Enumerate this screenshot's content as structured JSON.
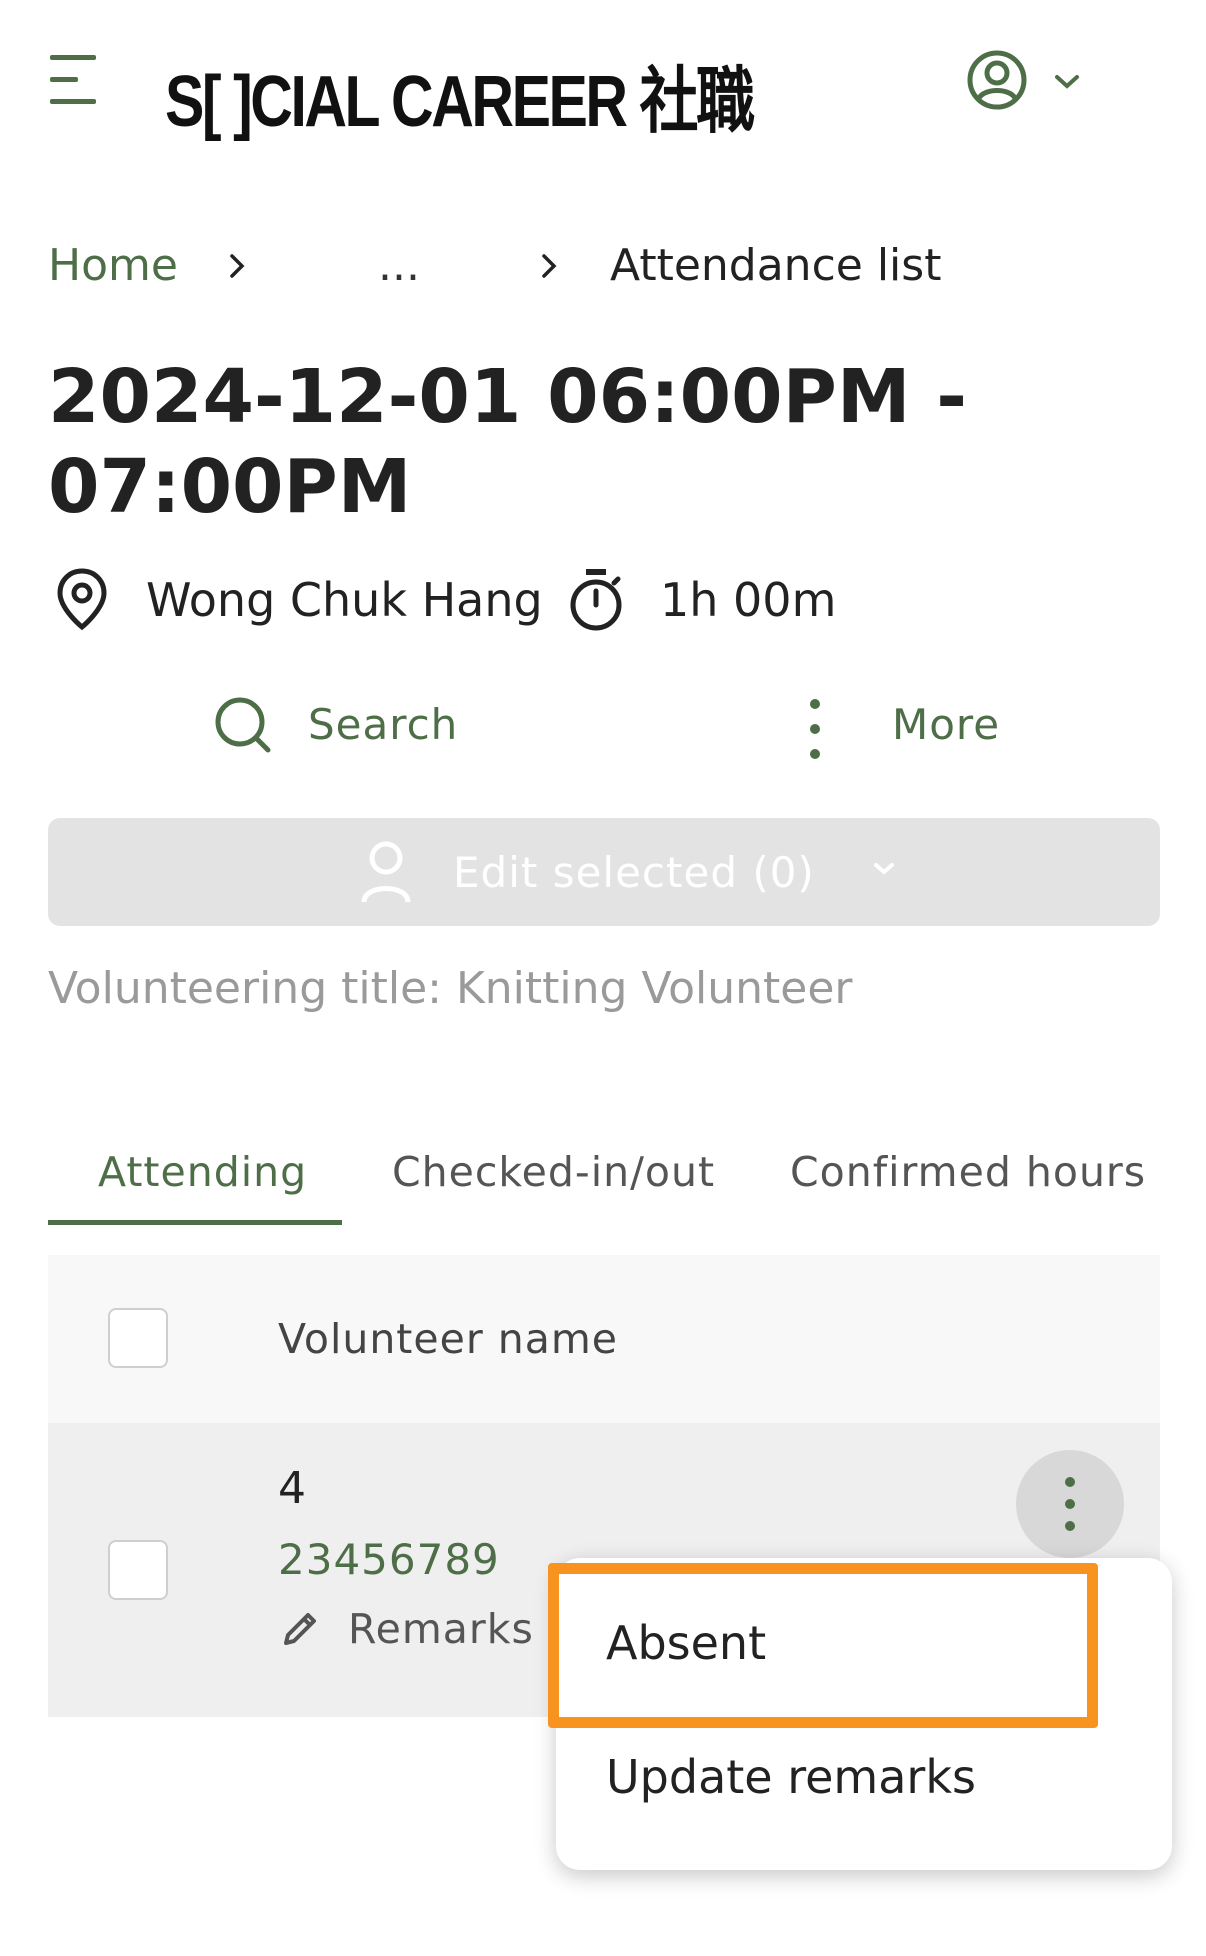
{
  "header": {
    "logo_text": "S[ ]CIAL CAREER 社職",
    "menu_icon": "hamburger-menu-icon",
    "account_icon": "account-circle-icon"
  },
  "breadcrumb": {
    "home": "Home",
    "ellipsis": "...",
    "current": "Attendance list"
  },
  "event": {
    "title": "2024-12-01 06:00PM - 07:00PM",
    "location": "Wong Chuk Hang",
    "duration": "1h 00m"
  },
  "actions": {
    "search_label": "Search",
    "more_label": "More",
    "edit_selected_label": "Edit selected (0)"
  },
  "volunteering_title": "Volunteering title: Knitting Volunteer",
  "tabs": [
    {
      "label": "Attending",
      "active": true
    },
    {
      "label": "Checked-in/out",
      "active": false
    },
    {
      "label": "Confirmed hours",
      "active": false
    }
  ],
  "table": {
    "header": {
      "column": "Volunteer name"
    },
    "rows": [
      {
        "id": "4",
        "phone": "23456789",
        "remarks_label": "Remarks"
      }
    ]
  },
  "context_menu": {
    "items": [
      {
        "label": "Absent",
        "highlighted": true
      },
      {
        "label": "Update remarks",
        "highlighted": false
      }
    ]
  },
  "colors": {
    "accent": "#4e6e48",
    "highlight": "#f7931e",
    "disabled_button": "#e3e3e3"
  }
}
